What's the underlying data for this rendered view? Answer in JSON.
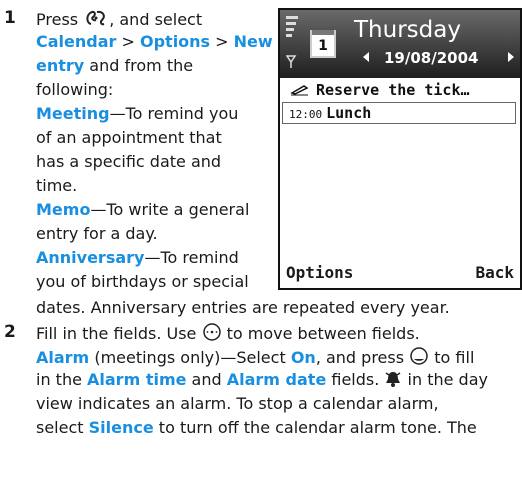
{
  "step1": {
    "number": "1",
    "l1_press": "Press",
    "l1_after": ", and select",
    "l2_calendar": "Calendar",
    "l2_sep1": " > ",
    "l2_options": "Options",
    "l2_sep2": " > ",
    "l2_new": "New",
    "l3_entry": "entry",
    "l3_rest": " and from the",
    "l4": "following:",
    "meeting_label": "Meeting",
    "meeting_dash": "—To remind you",
    "meeting_l2": "of an appointment that",
    "meeting_l3": "has a specific date and",
    "meeting_l4": "time.",
    "memo_label": "Memo",
    "memo_dash": "—To write a general",
    "memo_l2": "entry for a day.",
    "anniv_label": "Anniversary",
    "anniv_dash": "—To remind",
    "anniv_l2": "you of birthdays or special",
    "anniv_l3": "dates. Anniversary entries are repeated every year."
  },
  "step2": {
    "number": "2",
    "l1_a": "Fill in the fields. Use",
    "l1_b": "to move between fields.",
    "alarm_label": "Alarm",
    "alarm_mid": " (meetings only)—Select ",
    "on_label": "On",
    "alarm_end": ", and press",
    "alarm_end2": "to fill",
    "l3_a": "in the ",
    "alarm_time": "Alarm time",
    "l3_and": " and ",
    "alarm_date": "Alarm date",
    "l3_b": " fields.",
    "l3_c": "in the day",
    "l4": "view indicates an alarm. To stop a calendar alarm,",
    "l5_a": "select ",
    "silence": "Silence",
    "l5_b": " to turn off the calendar alarm tone. The"
  },
  "phone": {
    "day": "Thursday",
    "date": "19/08/2004",
    "calendar_icon_number": "1",
    "entry1": "Reserve the tick…",
    "entry2_time": "12:00",
    "entry2_title": "Lunch",
    "softkey_left": "Options",
    "softkey_right": "Back"
  },
  "colors": {
    "highlight": "#1a8fe0"
  },
  "icons": [
    "menu-key-icon",
    "navi-scroll-icon",
    "navi-select-icon",
    "alarm-bell-icon",
    "memo-pen-icon",
    "signal-icon"
  ]
}
